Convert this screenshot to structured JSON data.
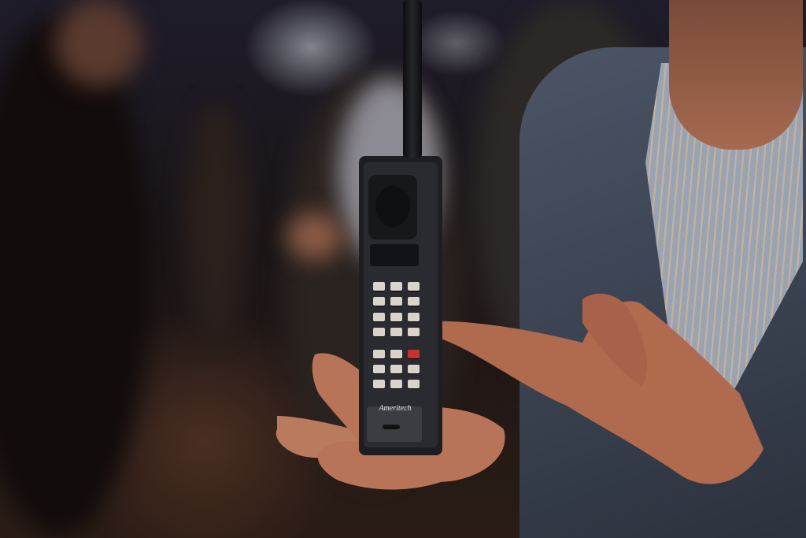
{
  "photo": {
    "subject": "hand-holding-vintage-mobile-phone",
    "phone_brand_text": "Ameritech"
  }
}
